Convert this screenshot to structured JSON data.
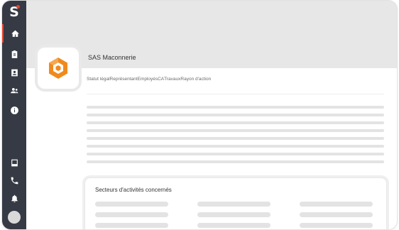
{
  "sidebar": {
    "logo_text": "S",
    "accent_color": "#e8432e",
    "items": [
      {
        "icon": "home-icon"
      },
      {
        "icon": "clipboard-icon"
      },
      {
        "icon": "contact-card-icon"
      },
      {
        "icon": "team-icon"
      },
      {
        "icon": "info-icon"
      },
      {
        "icon": "inbox-icon"
      },
      {
        "icon": "phone-icon"
      },
      {
        "icon": "bell-icon"
      }
    ]
  },
  "company": {
    "name": "SAS Maconnerie",
    "logo_color": "#f08a1c"
  },
  "info_tabs": [
    "Statut légal",
    "Représentant",
    "Employés",
    "CA",
    "Travaux",
    "Rayon d'action"
  ],
  "card": {
    "title": "Secteurs d'activités concernés"
  }
}
